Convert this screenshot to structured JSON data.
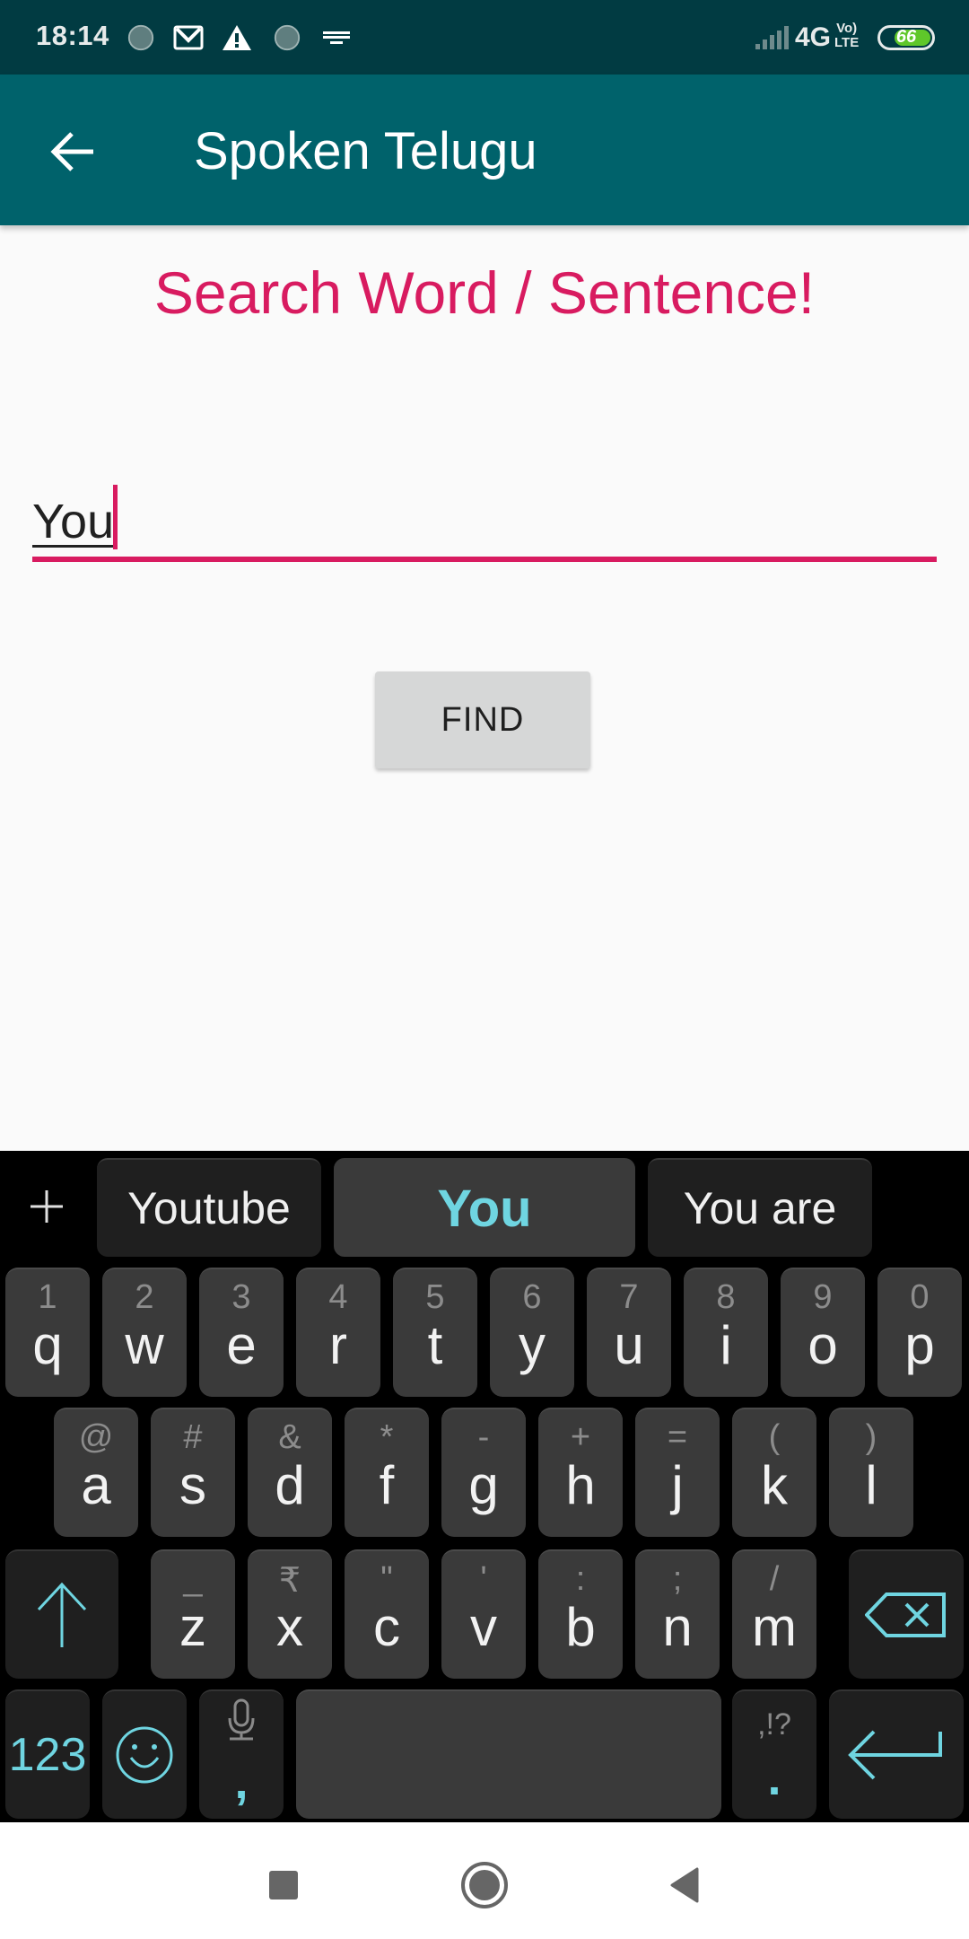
{
  "status_bar": {
    "time": "18:14",
    "notification_icons": [
      "sync-icon",
      "gmail-icon",
      "warning-icon",
      "sync-icon",
      "keyboard-icon"
    ],
    "network": "4G",
    "volte": "VoLTE",
    "battery_percent": "66",
    "colors": {
      "background": "#013b42",
      "battery_fill": "#5fc72a"
    }
  },
  "app_bar": {
    "title": "Spoken Telugu",
    "back_icon": "arrow-left-icon",
    "color": "#00626b"
  },
  "main": {
    "headline": "Search Word / Sentence!",
    "accent_color": "#d81b60",
    "search_input": {
      "value": "You",
      "placeholder": ""
    },
    "find_button": "FIND"
  },
  "keyboard": {
    "suggestions": [
      "Youtube",
      "You",
      "You are"
    ],
    "suggestion_add_icon": "plus-icon",
    "row1": [
      {
        "hint": "1",
        "key": "q"
      },
      {
        "hint": "2",
        "key": "w"
      },
      {
        "hint": "3",
        "key": "e"
      },
      {
        "hint": "4",
        "key": "r"
      },
      {
        "hint": "5",
        "key": "t"
      },
      {
        "hint": "6",
        "key": "y"
      },
      {
        "hint": "7",
        "key": "u"
      },
      {
        "hint": "8",
        "key": "i"
      },
      {
        "hint": "9",
        "key": "o"
      },
      {
        "hint": "0",
        "key": "p"
      }
    ],
    "row2": [
      {
        "hint": "@",
        "key": "a"
      },
      {
        "hint": "#",
        "key": "s"
      },
      {
        "hint": "&",
        "key": "d"
      },
      {
        "hint": "*",
        "key": "f"
      },
      {
        "hint": "-",
        "key": "g"
      },
      {
        "hint": "+",
        "key": "h"
      },
      {
        "hint": "=",
        "key": "j"
      },
      {
        "hint": "(",
        "key": "k"
      },
      {
        "hint": ")",
        "key": "l"
      }
    ],
    "row3": [
      {
        "hint": "_",
        "key": "z"
      },
      {
        "hint": "₹",
        "key": "x"
      },
      {
        "hint": "\"",
        "key": "c"
      },
      {
        "hint": "'",
        "key": "v"
      },
      {
        "hint": ":",
        "key": "b"
      },
      {
        "hint": ";",
        "key": "n"
      },
      {
        "hint": "/",
        "key": "m"
      }
    ],
    "symbols_key": "123",
    "comma_key": ",",
    "period_key": ".",
    "period_hint": ",!?",
    "accent_color": "#6fd5e1"
  },
  "nav_bar": {
    "buttons": [
      "recents-icon",
      "home-icon",
      "back-icon"
    ]
  }
}
